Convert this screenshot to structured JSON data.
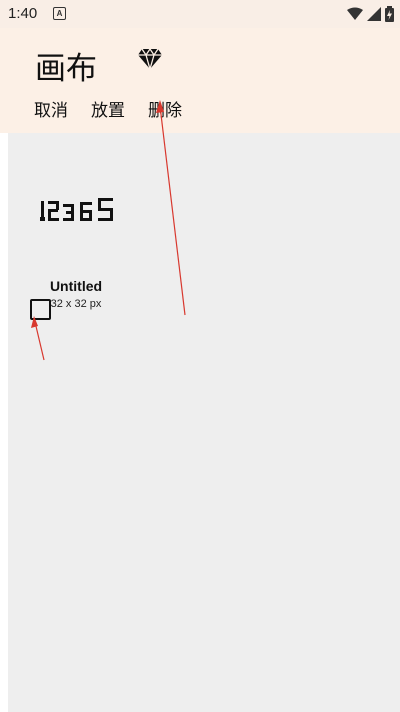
{
  "status": {
    "time": "1:40",
    "a_icon": "A"
  },
  "app": {
    "title": "画布",
    "actions": [
      "取消",
      "放置",
      "删除"
    ]
  },
  "card": {
    "title": "Untitled",
    "size": "32 x 32 px",
    "preview_text": "12365"
  },
  "colors": {
    "app_bar": "#fcf0e6",
    "canvas_bg": "#eeeeee",
    "arrow": "#d8382e"
  }
}
